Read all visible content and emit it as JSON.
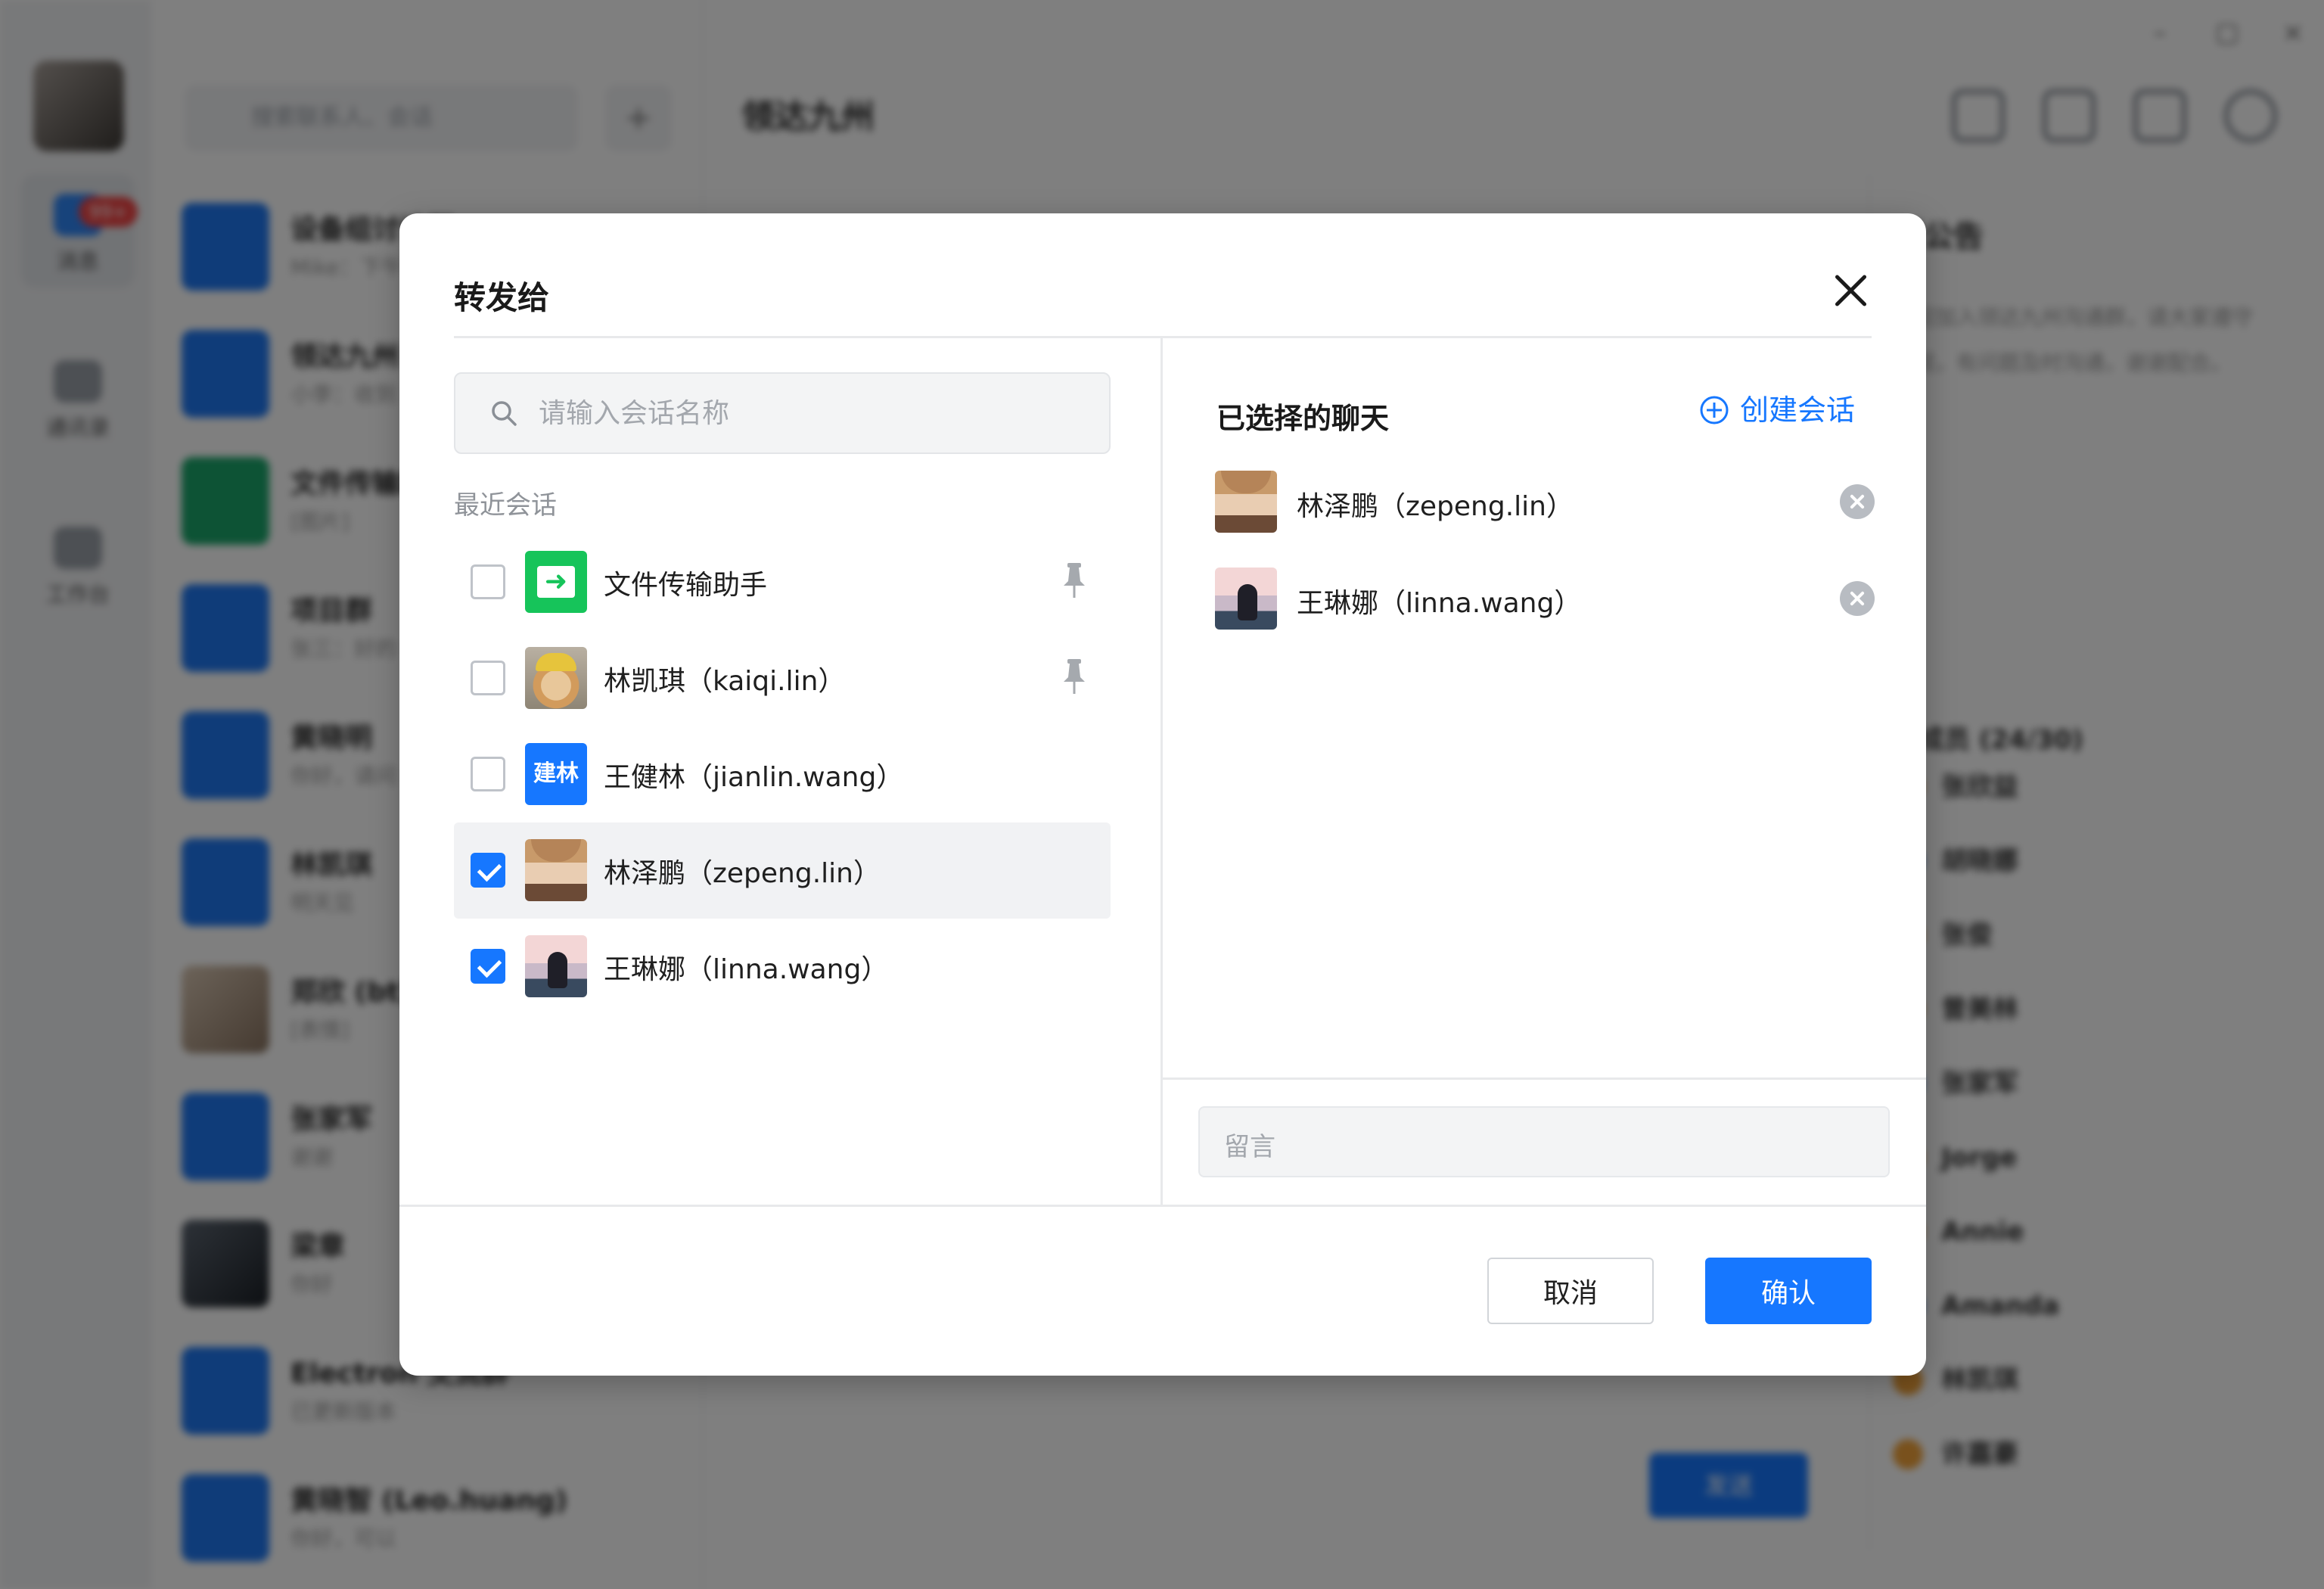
{
  "background": {
    "rail": {
      "badge": "99+",
      "items": [
        {
          "label": "消息"
        },
        {
          "label": "通讯录"
        },
        {
          "label": "工作台"
        }
      ]
    },
    "conversation_list": {
      "search_placeholder": "搜索联系人、会话",
      "add": "+",
      "rows": [
        {
          "name": "设备组讨论群",
          "msg": "Mike：下午开会"
        },
        {
          "name": "领达九州",
          "msg": "小李：收到"
        },
        {
          "name": "文件传输助手",
          "msg": "[图片]"
        },
        {
          "name": "项目群",
          "msg": "张三：好的"
        },
        {
          "name": "黄晓明",
          "msg": "你好，请问"
        },
        {
          "name": "林凯琪",
          "msg": "明天见"
        },
        {
          "name": "郑欣 (bt)",
          "msg": "[表情]"
        },
        {
          "name": "张家军",
          "msg": "谢谢"
        },
        {
          "name": "梁章",
          "msg": "你好"
        },
        {
          "name": "Electron 交流群",
          "msg": "已更新版本"
        },
        {
          "name": "黄晓智 (Leo.huang)",
          "msg": "你好，可以"
        }
      ]
    },
    "chat": {
      "title": "领达九州",
      "panel_title": "群公告",
      "panel_text": "欢迎加入领达九州沟通群，请大家遵守群规，有问题及时沟通，谢谢配合。",
      "members_title": "群成员 (24/30)",
      "members": [
        "张欣益",
        "胡晓娜",
        "张俊",
        "曾美林",
        "张家军",
        "Jorge",
        "Annie",
        "Amanda",
        "林凯琪",
        "许嘉豪"
      ],
      "send": "发送"
    }
  },
  "modal": {
    "title": "转发给",
    "search_placeholder": "请输入会话名称",
    "recent_label": "最近会话",
    "recent": [
      {
        "name": "文件传输助手",
        "checked": false,
        "pinned": true,
        "avatar": "file-transfer-icon"
      },
      {
        "name": "林凯琪（kaiqi.lin）",
        "checked": false,
        "pinned": true,
        "avatar": "cat-photo"
      },
      {
        "name": "王健林（jianlin.wang）",
        "checked": false,
        "pinned": false,
        "avatar_text": "建林"
      },
      {
        "name": "林泽鹏（zepeng.lin）",
        "checked": true,
        "pinned": false,
        "avatar": "boy-photo",
        "highlighted": true
      },
      {
        "name": "王琳娜（linna.wang）",
        "checked": true,
        "pinned": false,
        "avatar": "girl-photo"
      }
    ],
    "selected_title": "已选择的聊天",
    "create_label": "创建会话",
    "selected": [
      {
        "name": "林泽鹏（zepeng.lin）",
        "avatar": "boy-photo"
      },
      {
        "name": "王琳娜（linna.wang）",
        "avatar": "girl-photo"
      }
    ],
    "message_placeholder": "留言",
    "cancel_label": "取消",
    "confirm_label": "确认"
  },
  "colors": {
    "accent": "#1677ff",
    "file_green": "#16c45a",
    "overlay": "rgba(0,0,0,0.5)"
  }
}
